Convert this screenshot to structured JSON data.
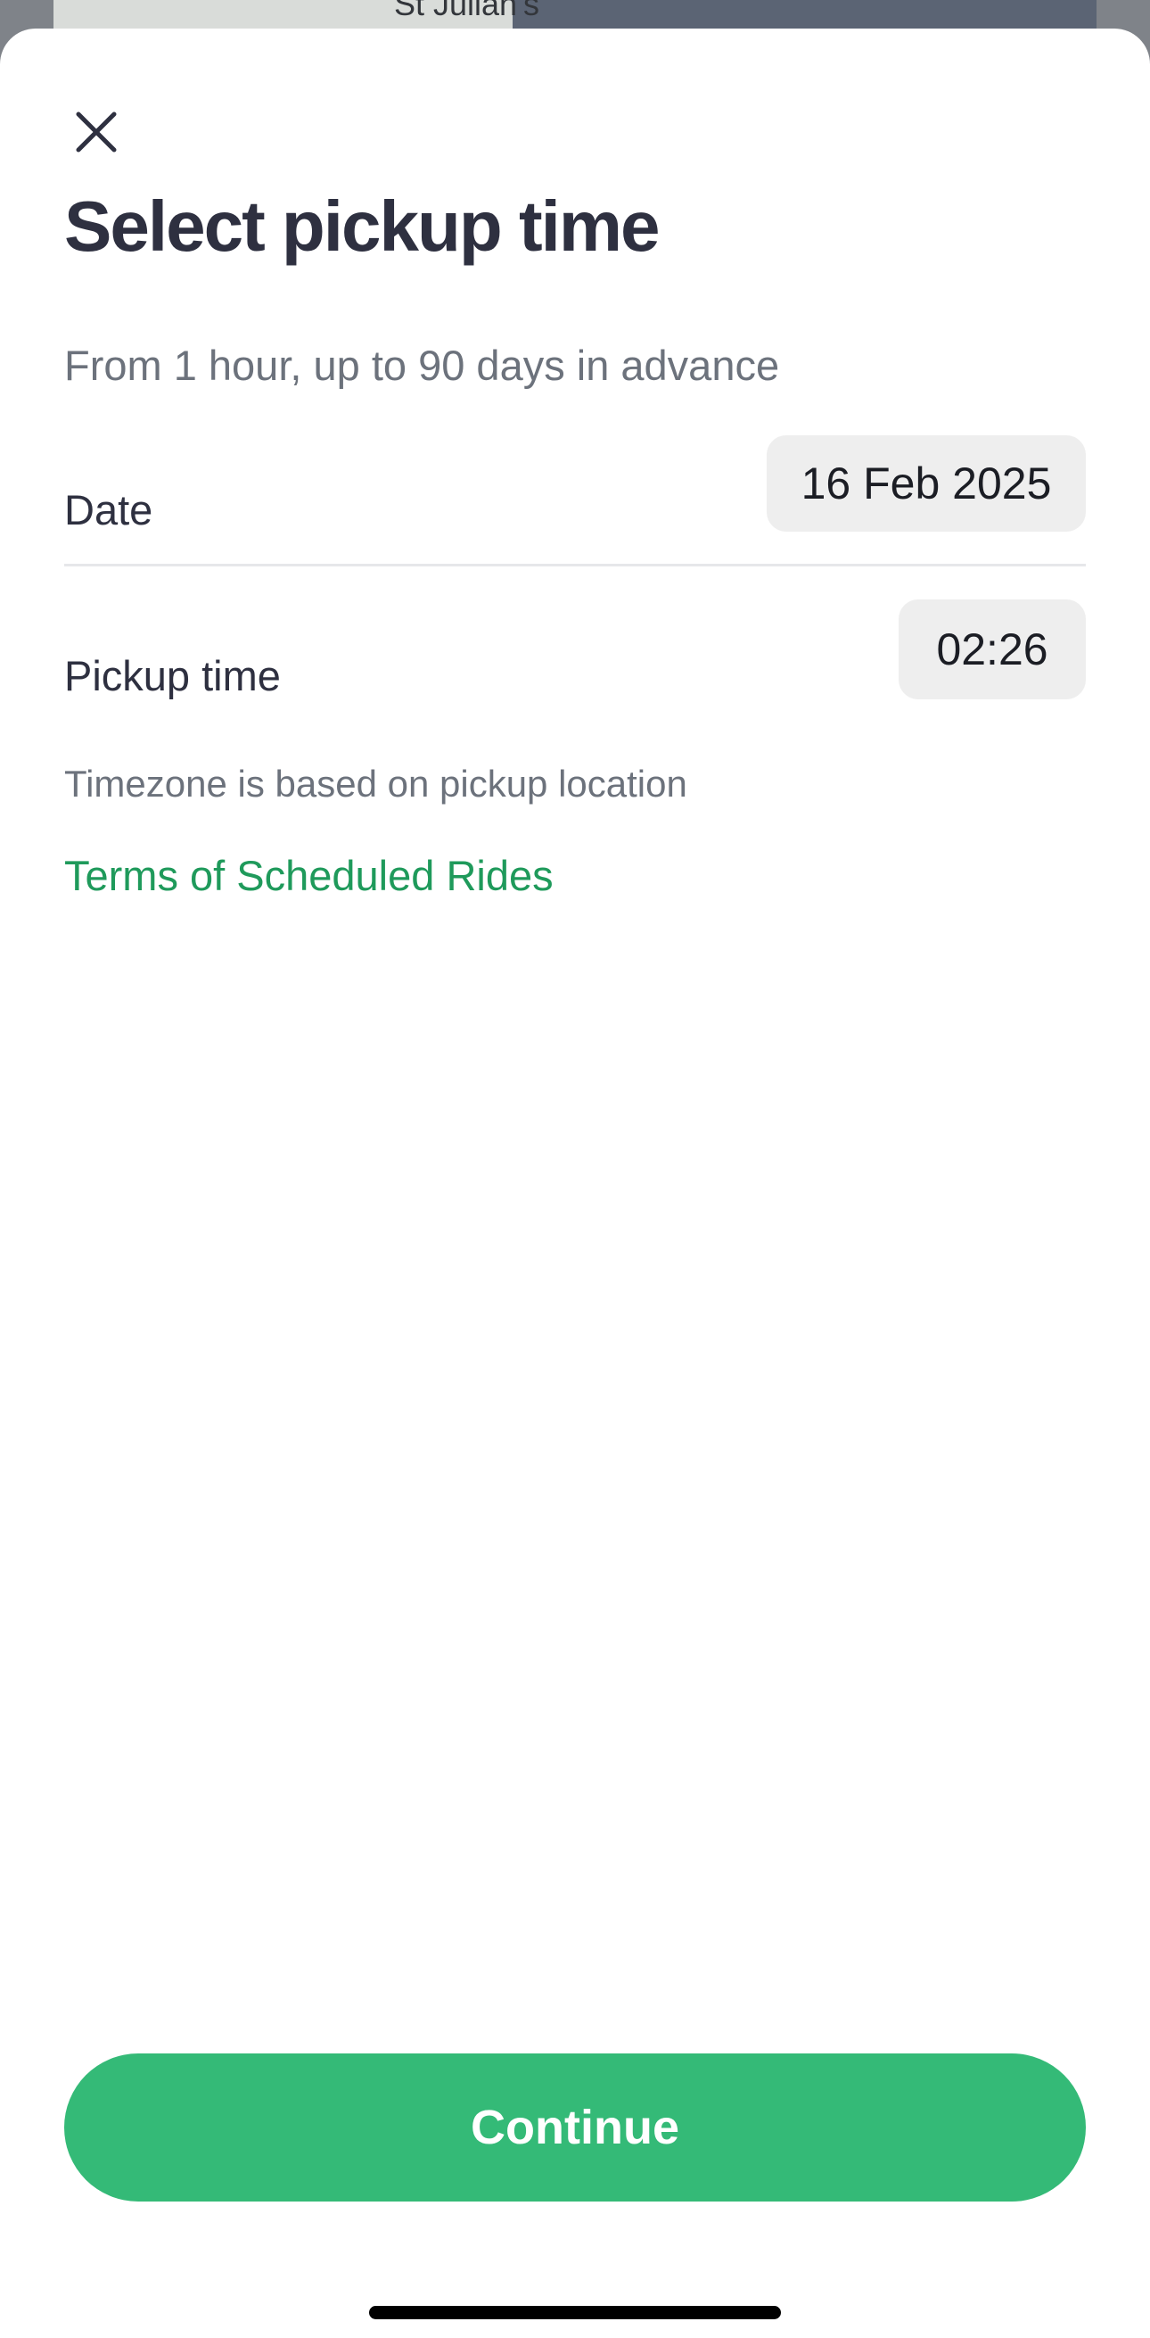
{
  "background": {
    "map_label": "St Julian's"
  },
  "sheet": {
    "close_icon": "close-icon",
    "title": "Select pickup time",
    "subtitle": "From 1 hour, up to 90 days in advance",
    "date": {
      "label": "Date",
      "value": "16 Feb 2025"
    },
    "pickup_time": {
      "label": "Pickup time",
      "value": "02:26"
    },
    "timezone_note": "Timezone is based on pickup location",
    "terms_link": "Terms of Scheduled Rides",
    "continue_label": "Continue"
  },
  "colors": {
    "accent": "#34ba77",
    "link": "#1f9a5b",
    "title": "#2e3040",
    "muted": "#6c727c",
    "pill_bg": "#eeeeee"
  }
}
